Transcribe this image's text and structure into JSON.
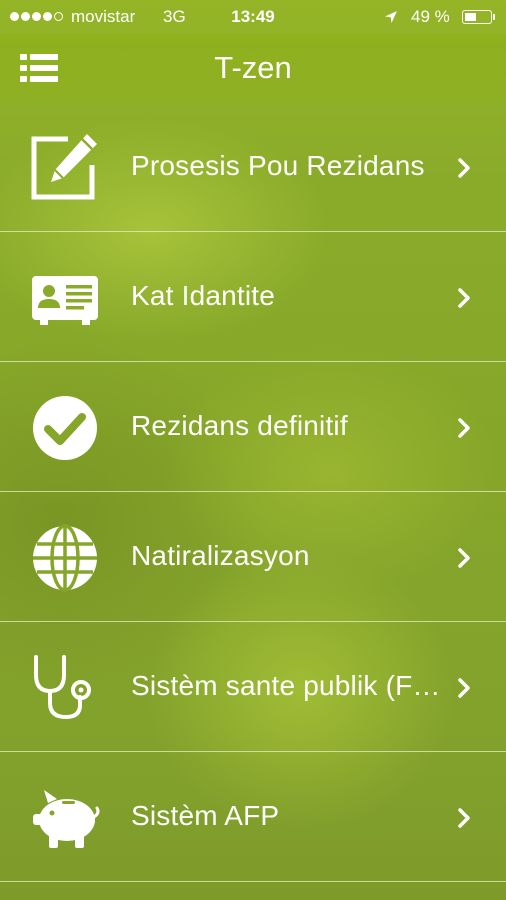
{
  "status_bar": {
    "signal_dots_filled": 4,
    "signal_dots_total": 5,
    "carrier": "movistar",
    "network": "3G",
    "time": "13:49",
    "location_icon": "location-arrow-icon",
    "battery_text": "49 %",
    "battery_level": 0.49
  },
  "nav": {
    "title": "T-zen",
    "menu_icon": "list-menu-icon"
  },
  "menu_items": [
    {
      "label": "Prosesis Pou Rezidans",
      "icon": "edit-form-icon"
    },
    {
      "label": "Kat Idantite",
      "icon": "id-card-icon"
    },
    {
      "label": "Rezidans definitif",
      "icon": "check-circle-icon"
    },
    {
      "label": "Natiralizasyon",
      "icon": "globe-icon"
    },
    {
      "label": "Sistèm sante publik (F…",
      "icon": "stethoscope-icon"
    },
    {
      "label": "Sistèm AFP",
      "icon": "piggy-bank-icon"
    }
  ],
  "colors": {
    "background": "#86a62a",
    "nav_bar": "#8cb014",
    "text": "#ffffff",
    "separator": "#e6f0be"
  }
}
